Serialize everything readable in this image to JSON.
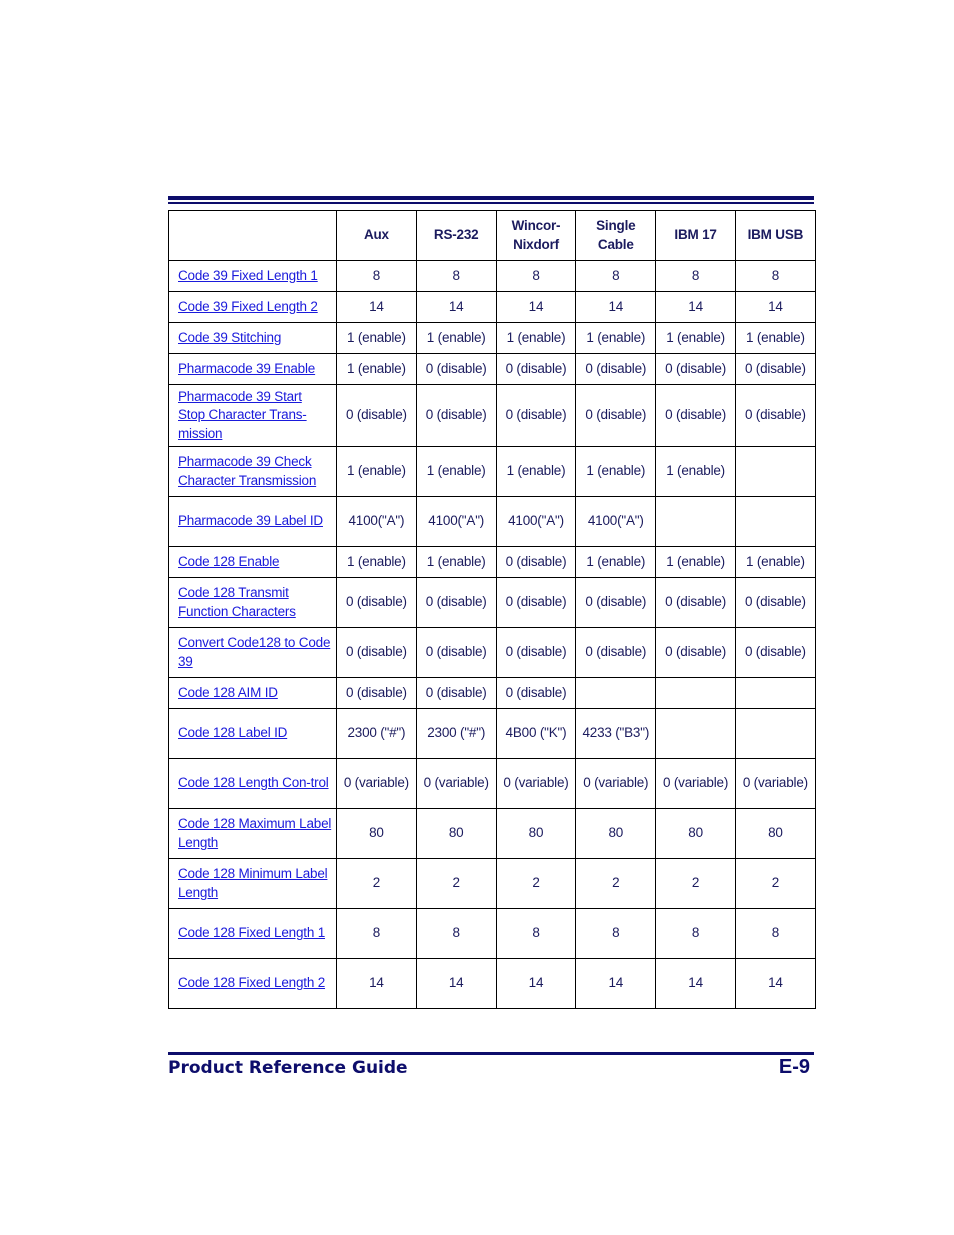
{
  "table": {
    "headers": [
      "",
      "Aux",
      "RS-232",
      "Wincor-\nNixdorf",
      "Single\nCable",
      "IBM 17",
      "IBM USB"
    ],
    "rows": [
      {
        "param": "Code 39 Fixed Length 1",
        "values": [
          "8",
          "8",
          "8",
          "8",
          "8",
          "8"
        ]
      },
      {
        "param": "Code 39 Fixed Length 2",
        "values": [
          "14",
          "14",
          "14",
          "14",
          "14",
          "14"
        ]
      },
      {
        "param": "Code 39 Stitching",
        "values": [
          "1 (enable)",
          "1 (enable)",
          "1 (enable)",
          "1 (enable)",
          "1 (enable)",
          "1 (enable)"
        ]
      },
      {
        "param": "Pharmacode 39 Enable",
        "values": [
          "1 (enable)",
          "0 (disable)",
          "0 (disable)",
          "0 (disable)",
          "0 (disable)",
          "0 (disable)"
        ]
      },
      {
        "param": "Pharmacode 39 Start Stop Character Trans-mission",
        "values": [
          "0 (disable)",
          "0 (disable)",
          "0 (disable)",
          "0 (disable)",
          "0 (disable)",
          "0 (disable)"
        ]
      },
      {
        "param": "Pharmacode 39 Check Character Transmission",
        "values": [
          "1 (enable)",
          "1 (enable)",
          "1 (enable)",
          "1 (enable)",
          "1 (enable)",
          ""
        ]
      },
      {
        "param": "Pharmacode 39 Label ID",
        "values": [
          "4100(\"A\")",
          "4100(\"A\")",
          "4100(\"A\")",
          "4100(\"A\")",
          "",
          ""
        ]
      },
      {
        "param": "Code 128 Enable",
        "values": [
          "1 (enable)",
          "1 (enable)",
          "0 (disable)",
          "1 (enable)",
          "1 (enable)",
          "1 (enable)"
        ]
      },
      {
        "param": "Code 128 Transmit Function Characters",
        "values": [
          "0 (disable)",
          "0 (disable)",
          "0 (disable)",
          "0 (disable)",
          "0 (disable)",
          "0 (disable)"
        ]
      },
      {
        "param": "Convert Code128 to Code 39",
        "values": [
          "0 (disable)",
          "0 (disable)",
          "0 (disable)",
          "0 (disable)",
          "0 (disable)",
          "0 (disable)"
        ]
      },
      {
        "param": "Code 128 AIM ID",
        "values": [
          "0 (disable)",
          "0 (disable)",
          "0 (disable)",
          "",
          "",
          ""
        ]
      },
      {
        "param": "Code 128 Label ID",
        "values": [
          "2300 (\"#\")",
          "2300 (\"#\")",
          "4B00 (\"K\")",
          "4233 (\"B3\")",
          "",
          ""
        ]
      },
      {
        "param": "Code 128 Length Con-trol",
        "values": [
          "0 (variable)",
          "0 (variable)",
          "0 (variable)",
          "0 (variable)",
          "0 (variable)",
          "0 (variable)"
        ]
      },
      {
        "param": "Code 128 Maximum Label Length",
        "values": [
          "80",
          "80",
          "80",
          "80",
          "80",
          "80"
        ]
      },
      {
        "param": "Code 128 Minimum Label Length",
        "values": [
          "2",
          "2",
          "2",
          "2",
          "2",
          "2"
        ]
      },
      {
        "param": "Code 128 Fixed Length 1",
        "values": [
          "8",
          "8",
          "8",
          "8",
          "8",
          "8"
        ]
      },
      {
        "param": "Code 128 Fixed Length 2",
        "values": [
          "14",
          "14",
          "14",
          "14",
          "14",
          "14"
        ]
      }
    ]
  },
  "footer": {
    "title": "Product Reference Guide",
    "page": "E-9"
  },
  "colors": {
    "rule": "#0d0d6b",
    "link": "#1a1adb",
    "text": "#1b1b5e"
  }
}
